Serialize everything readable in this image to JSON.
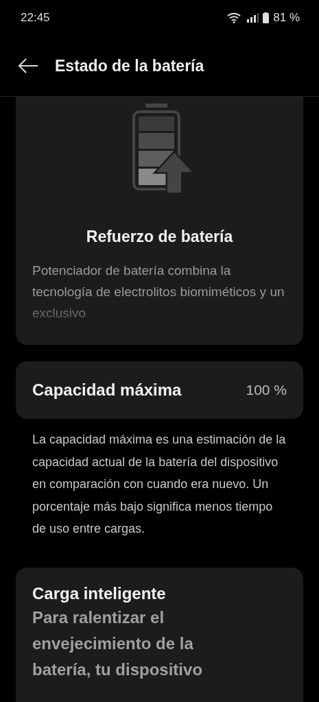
{
  "status_bar": {
    "time": "22:45",
    "battery": "81 %"
  },
  "header": {
    "title": "Estado de la batería"
  },
  "boost_card": {
    "title": "Refuerzo de batería",
    "description": "Potenciador de batería combina la tecnología de electrolitos biomiméticos y un exclusivo"
  },
  "capacity": {
    "label": "Capacidad máxima",
    "value": "100 %",
    "description": "La capacidad máxima es una estimación de la capacidad actual de la batería del dispositivo en comparación con cuando era nuevo. Un porcentaje más bajo significa menos tiempo de uso entre cargas."
  },
  "smart_charge_card": {
    "title": "Carga inteligente",
    "description": "Para ralentizar el envejecimiento de la batería, tu dispositivo"
  }
}
